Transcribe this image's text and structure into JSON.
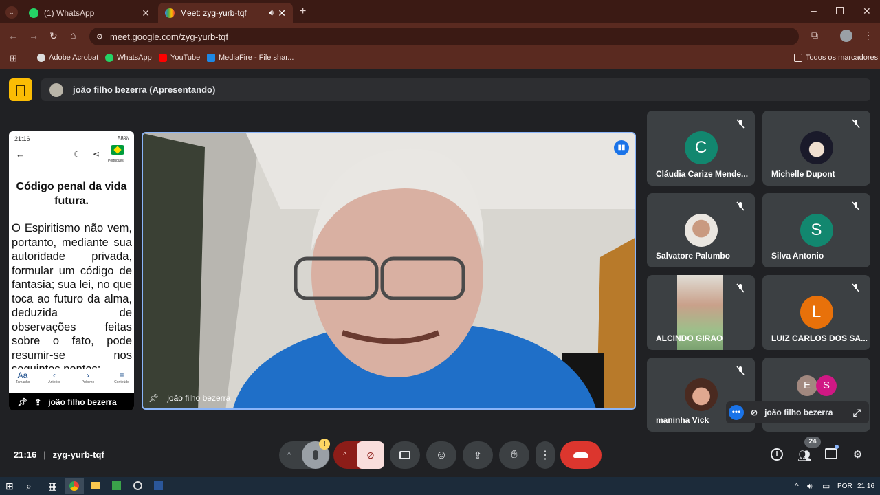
{
  "browser": {
    "tabs": [
      {
        "label": "(1) WhatsApp",
        "color": "#25d366"
      },
      {
        "label": "Meet: zyg-yurb-tqf",
        "color": "#34a853"
      }
    ],
    "url": "meet.google.com/zyg-yurb-tqf",
    "bookmarks": [
      "Adobe Acrobat",
      "WhatsApp",
      "YouTube",
      "MediaFire - File shar..."
    ],
    "all_bookmarks": "Todos os marcadores"
  },
  "meet": {
    "presenter_label": "joão filho bezerra (Apresentando)",
    "phone": {
      "time": "21:16",
      "battery": "58%",
      "lang": "Português",
      "title": "Código penal da vida futura.",
      "body": "O Espiritismo não vem, portanto, mediante sua autoridade privada, formular um código de fantasia; sua lei, no que toca ao futuro da alma, deduzida de observações feitas sobre o fato, pode resumir-se nos seguintes pontos:",
      "nav": [
        "Tamanho",
        "Anterior",
        "Próximo",
        "Conteúdo"
      ],
      "nav_aa": "Aa",
      "footer_name": "joão filho bezerra"
    },
    "main_video_name": "joão filho bezerra",
    "participants": [
      {
        "name": "Cláudia Carize Mende...",
        "initial": "C",
        "color": "#12876f"
      },
      {
        "name": "Michelle Dupont",
        "initial": "",
        "color": "#1a1a1a"
      },
      {
        "name": "Salvatore Palumbo",
        "initial": "",
        "color": "#c8a890"
      },
      {
        "name": "Silva Antonio",
        "initial": "S",
        "color": "#12876f"
      },
      {
        "name": "ALCINDO GIRAO",
        "initial": "",
        "color": "#b9b4a8"
      },
      {
        "name": "LUIZ CARLOS DOS SA...",
        "initial": "L",
        "color": "#e8710a"
      },
      {
        "name": "maninha Vick",
        "initial": "",
        "color": "#d09080"
      }
    ],
    "others": {
      "initials": [
        "E",
        "S"
      ],
      "colors": [
        "#a1887f",
        "#d01884"
      ],
      "self_name": "joão filho bezerra"
    },
    "footer": {
      "time": "21:16",
      "separator": "|",
      "code": "zyg-yurb-tqf",
      "people_count": "24",
      "mic_warning": "!"
    }
  },
  "taskbar": {
    "lang": "POR",
    "time": "21:16"
  }
}
